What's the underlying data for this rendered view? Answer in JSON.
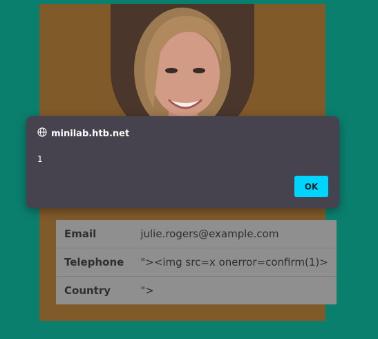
{
  "dialog": {
    "origin": "minilab.htb.net",
    "origin_icon": "globe-icon",
    "message": "1",
    "ok_label": "OK"
  },
  "profile": {
    "fields": [
      {
        "label": "Email",
        "value": "julie.rogers@example.com"
      },
      {
        "label": "Telephone",
        "value": "\"><img src=x onerror=confirm(1)>"
      },
      {
        "label": "Country",
        "value": "\">"
      }
    ]
  },
  "colors": {
    "background": "#0b7f6e",
    "card": "#815a2a",
    "table": "#8f8f8f",
    "dialog": "#46434f",
    "ok_button": "#00d5ff"
  }
}
